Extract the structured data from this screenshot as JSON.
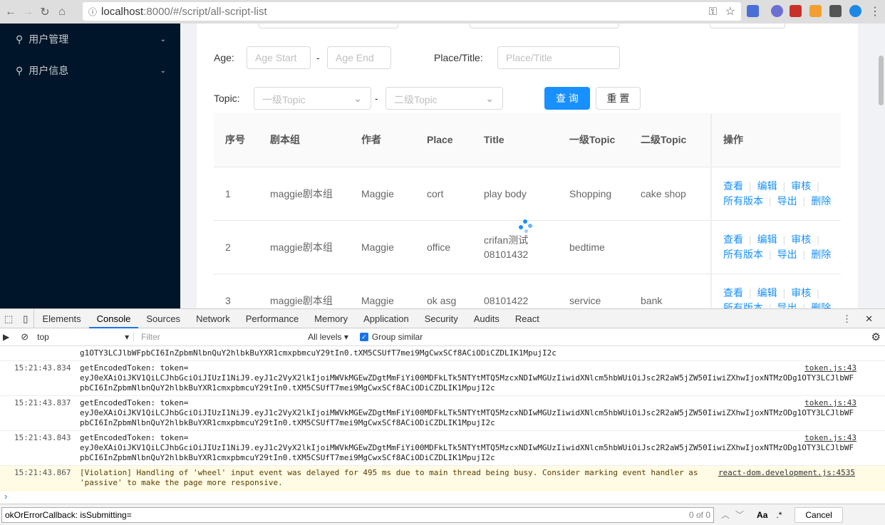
{
  "browser": {
    "url_host": "localhost",
    "url_rest": ":8000/#/script/all-script-list"
  },
  "sidebar": {
    "items": [
      {
        "label": "用户管理"
      },
      {
        "label": "用户信息"
      }
    ]
  },
  "filters": {
    "age_label": "Age:",
    "age_start": "Age Start",
    "age_end": "Age End",
    "dash": "-",
    "place_label": "Place/Title:",
    "place_placeholder": "Place/Title",
    "topic_label": "Topic:",
    "topic1": "一级Topic",
    "topic2": "二级Topic",
    "search": "查 询",
    "reset": "重 置"
  },
  "table": {
    "headers": [
      "序号",
      "剧本组",
      "作者",
      "Place",
      "Title",
      "一级Topic",
      "二级Topic",
      "操作"
    ],
    "rows": [
      [
        "1",
        "maggie剧本组",
        "Maggie",
        "cort",
        "play body",
        "Shopping",
        "cake shop"
      ],
      [
        "2",
        "maggie剧本组",
        "Maggie",
        "office",
        "crifan测试 08101432",
        "bedtime",
        ""
      ],
      [
        "3",
        "maggie剧本组",
        "Maggie",
        "ok asg",
        "08101422",
        "service",
        "bank"
      ]
    ],
    "ops": [
      "查看",
      "编辑",
      "审核",
      "所有版本",
      "导出",
      "删除"
    ]
  },
  "devtools": {
    "tabs": [
      "Elements",
      "Console",
      "Sources",
      "Network",
      "Performance",
      "Memory",
      "Application",
      "Security",
      "Audits",
      "React"
    ],
    "context": "top",
    "filter_placeholder": "Filter",
    "levels": "All levels",
    "group_similar": "Group similar",
    "partial_log": "g1OTY3LCJlbWFpbCI6InZpbmNlbnQuY2hlbkBuYXR1cmxpbmcuY29tIn0.tXM5CSUfT7mei9MgCwxSCf8ACiODiCZDLIK1MpujI2c",
    "logs": [
      {
        "ts": "15:21:43.834",
        "msg": "getEncodedToken: token=",
        "token": "eyJ0eXAiOiJKV1QiLCJhbGciOiJIUzI1NiJ9.eyJ1c2VyX2lkIjoiMWVkMGEwZDgtMmFiYi00MDFkLTk5NTYtMTQ5MzcxNDIwMGUzIiwidXNlcm5hbWUiOiJsc2R2aW5jZW50IiwiZXhwIjoxNTMzODg1OTY3LCJlbWFpbCI6InZpbmNlbnQuY2hlbkBuYXR1cmxpbmcuY29tIn0.tXM5CSUfT7mei9MgCwxSCf8ACiODiCZDLIK1MpujI2c",
        "src": "token.js:43"
      },
      {
        "ts": "15:21:43.837",
        "msg": "getEncodedToken: token=",
        "token": "eyJ0eXAiOiJKV1QiLCJhbGciOiJIUzI1NiJ9.eyJ1c2VyX2lkIjoiMWVkMGEwZDgtMmFiYi00MDFkLTk5NTYtMTQ5MzcxNDIwMGUzIiwidXNlcm5hbWUiOiJsc2R2aW5jZW50IiwiZXhwIjoxNTMzODg1OTY3LCJlbWFpbCI6InZpbmNlbnQuY2hlbkBuYXR1cmxpbmcuY29tIn0.tXM5CSUfT7mei9MgCwxSCf8ACiODiCZDLIK1MpujI2c",
        "src": "token.js:43"
      },
      {
        "ts": "15:21:43.843",
        "msg": "getEncodedToken: token=",
        "token": "eyJ0eXAiOiJKV1QiLCJhbGciOiJIUzI1NiJ9.eyJ1c2VyX2lkIjoiMWVkMGEwZDgtMmFiYi00MDFkLTk5NTYtMTQ5MzcxNDIwMGUzIiwidXNlcm5hbWUiOiJsc2R2aW5jZW50IiwiZXhwIjoxNTMzODg1OTY3LCJlbWFpbCI6InZpbmNlbnQuY2hlbkBuYXR1cmxpbmcuY29tIn0.tXM5CSUfT7mei9MgCwxSCf8ACiODiCZDLIK1MpujI2c",
        "src": "token.js:43"
      }
    ],
    "violation": {
      "ts": "15:21:43.867",
      "msg": "[Violation] Handling of 'wheel' input event was delayed for 495 ms due to main thread being busy. Consider marking event handler as 'passive' to make the page more responsive.",
      "src": "react-dom.development.js:4535"
    },
    "search_value": "okOrErrorCallback: isSubmitting=",
    "match_count": "0 of 0",
    "case": "Aa",
    "regex": ".*",
    "cancel": "Cancel"
  }
}
